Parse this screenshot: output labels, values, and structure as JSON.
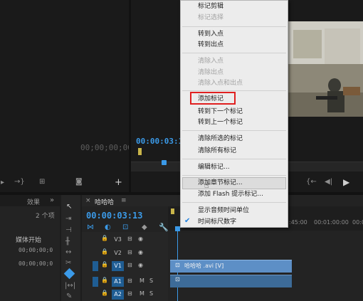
{
  "source_monitor": {
    "timecode": "00;00;00;00"
  },
  "program_monitor": {
    "timecode": "00:00:03:13"
  },
  "context_menu": {
    "items": [
      {
        "label": "标记剪辑",
        "enabled": true
      },
      {
        "label": "标记选择",
        "enabled": false
      },
      {
        "label": "转到入点",
        "enabled": true
      },
      {
        "label": "转到出点",
        "enabled": true
      },
      {
        "label": "清除入点",
        "enabled": false
      },
      {
        "label": "清除出点",
        "enabled": false
      },
      {
        "label": "清除入点和出点",
        "enabled": false
      },
      {
        "label": "添加标记",
        "enabled": true
      },
      {
        "label": "转到下一个标记",
        "enabled": true
      },
      {
        "label": "转到上一个标记",
        "enabled": true
      },
      {
        "label": "清除所选的标记",
        "enabled": true
      },
      {
        "label": "清除所有标记",
        "enabled": true
      },
      {
        "label": "编辑标记...",
        "enabled": true
      },
      {
        "label": "添加章节标记...",
        "enabled": true
      },
      {
        "label": "添加 Flash 提示标记...",
        "enabled": true
      },
      {
        "label": "显示音频时间单位",
        "enabled": true
      },
      {
        "label": "时间标尺数字",
        "enabled": true,
        "checked": true
      }
    ]
  },
  "project_panel": {
    "tab_effects": "效果",
    "items_count": "2 个项",
    "col_media_start": "媒体开始",
    "row_values": [
      "00;00;00;0",
      "00;00;00;0"
    ]
  },
  "timeline": {
    "tab_title": "哈哈哈",
    "timecode": "00:00:03:13",
    "ruler_labels": [
      ":45:00",
      "00:01:00:00",
      "00:0"
    ],
    "tracks": [
      {
        "id": "V3",
        "selected": false
      },
      {
        "id": "V2",
        "selected": false
      },
      {
        "id": "V1",
        "selected": true
      },
      {
        "id": "A1",
        "selected": true
      },
      {
        "id": "A2",
        "selected": true
      }
    ],
    "track_flags": {
      "m": "M",
      "s": "S"
    },
    "video_clip_label": "哈哈哈 .avi [V]"
  },
  "colors": {
    "accent_blue": "#3b9ae8",
    "highlight_red": "#e02020",
    "clip_blue": "#5d8fc6"
  }
}
